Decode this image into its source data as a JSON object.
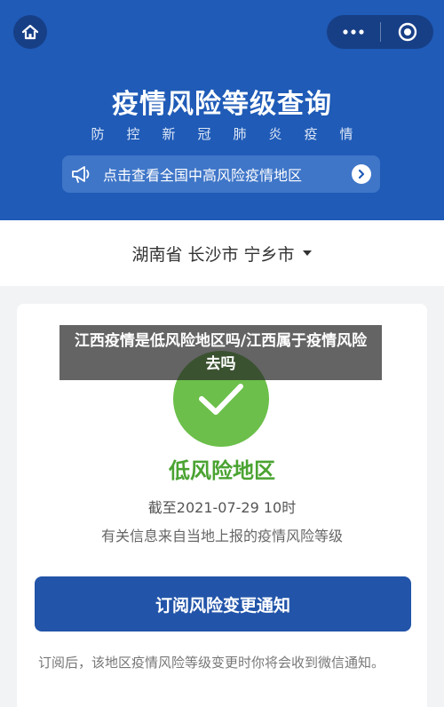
{
  "nav": {
    "home_icon": "home-icon",
    "more_icon": "more-dots-icon",
    "close_icon": "target-icon"
  },
  "header": {
    "title": "疫情风险等级查询",
    "subtitle_chars": [
      "防",
      "控",
      "新",
      "冠",
      "肺",
      "炎",
      "疫",
      "情"
    ],
    "notice_text": "点击查看全国中高风险疫情地区",
    "bg_color": "#1f5bb7"
  },
  "location": {
    "text": "湖南省 长沙市 宁乡市"
  },
  "card": {
    "risk_level": "低风险地区",
    "risk_color": "#6bbf4a",
    "updated": "截至2021-07-29 10时",
    "source": "有关信息来自当地上报的疫情风险等级",
    "subscribe_label": "订阅风险变更通知",
    "subscribe_note": "订阅后，该地区疫情风险等级变更时你将会收到微信通知。"
  },
  "overlay": {
    "caption": "江西疫情是低风险地区吗/江西属于疫情风险去吗"
  }
}
